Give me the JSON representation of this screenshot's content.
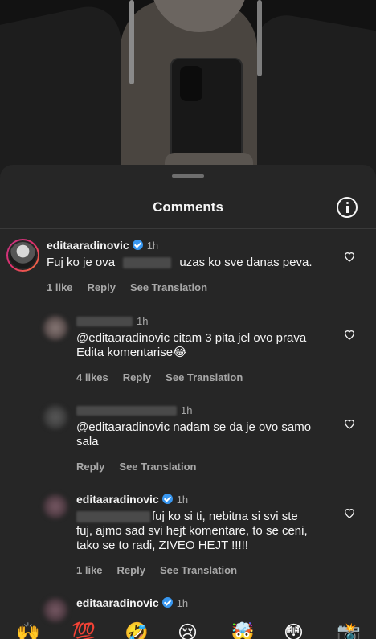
{
  "sheet": {
    "title": "Comments"
  },
  "comments": [
    {
      "username": "editaaradinovic",
      "time": "1h",
      "text_before": "Fuj ko je ova",
      "text_after": "uzas ko sve danas peva.",
      "likes": "1 like",
      "reply": "Reply",
      "translate": "See Translation"
    },
    {
      "time": "1h",
      "text_line1": "@editaaradinovic citam 3 pita jel ovo prava",
      "text_line2": "Edita komentarise😂",
      "likes": "4 likes",
      "reply": "Reply",
      "translate": "See Translation"
    },
    {
      "time": "1h",
      "text_line1": "@editaaradinovic nadam se da je ovo samo",
      "text_line2": "sala",
      "reply": "Reply",
      "translate": "See Translation"
    },
    {
      "username": "editaaradinovic",
      "time": "1h",
      "text_line1": "fuj ko si ti, nebitna si svi ste",
      "text_line2": "fuj, ajmo sad svi hejt komentare, to se ceni,",
      "text_line3": "tako se to radi, ZIVEO HEJT !!!!!",
      "likes": "1 like",
      "reply": "Reply",
      "translate": "See Translation"
    },
    {
      "username": "editaaradinovic",
      "time": "1h"
    }
  ],
  "emoji_bar": [
    "🙌",
    "💯",
    "🤣",
    "😢",
    "🤯",
    "😳",
    "📸"
  ],
  "colors": {
    "sheet": "#262626",
    "verified": "#3897f0",
    "muted": "#a8a8a8"
  }
}
